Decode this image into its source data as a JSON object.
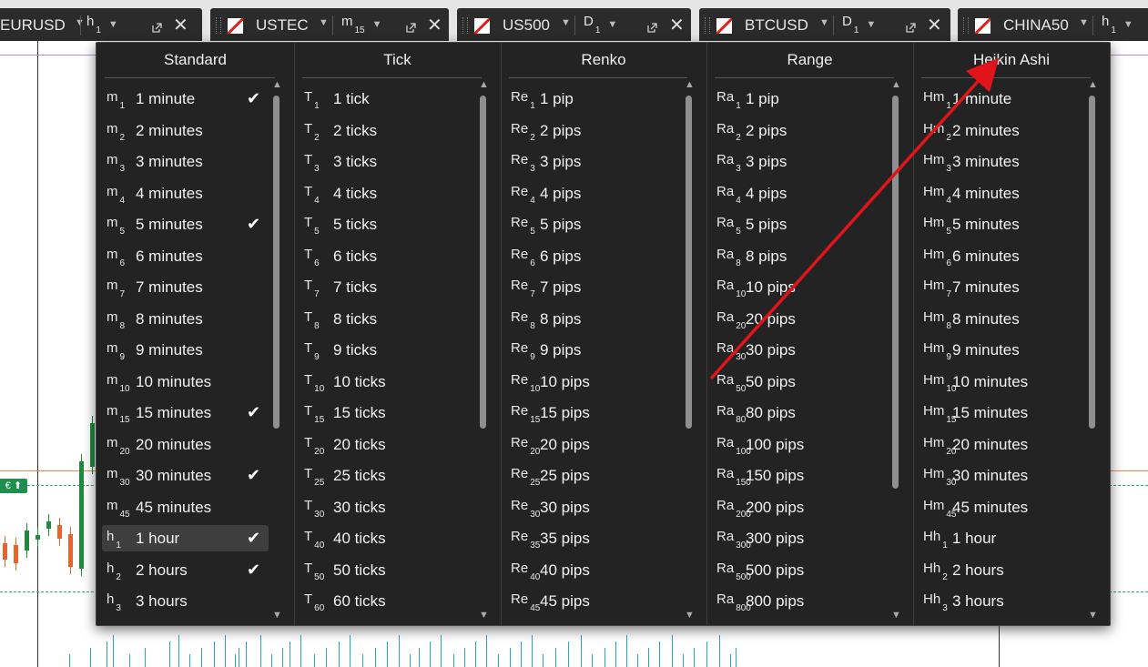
{
  "tabs": [
    {
      "symbol": "EURUSD",
      "timeframe": "h",
      "timeframe_sub": "1",
      "has_flag": false
    },
    {
      "symbol": "USTEC",
      "timeframe": "m",
      "timeframe_sub": "15",
      "has_flag": true
    },
    {
      "symbol": "US500",
      "timeframe": "D",
      "timeframe_sub": "1",
      "has_flag": true
    },
    {
      "symbol": "BTCUSD",
      "timeframe": "D",
      "timeframe_sub": "1",
      "has_flag": true
    },
    {
      "symbol": "CHINA50",
      "timeframe": "h",
      "timeframe_sub": "1",
      "has_flag": true
    }
  ],
  "price_badge": "€ ⬆",
  "columns": [
    {
      "title": "Standard",
      "items": [
        {
          "code": "m",
          "sub": "1",
          "label": "1 minute",
          "checked": true
        },
        {
          "code": "m",
          "sub": "2",
          "label": "2 minutes",
          "checked": false
        },
        {
          "code": "m",
          "sub": "3",
          "label": "3 minutes",
          "checked": false
        },
        {
          "code": "m",
          "sub": "4",
          "label": "4 minutes",
          "checked": false
        },
        {
          "code": "m",
          "sub": "5",
          "label": "5 minutes",
          "checked": true
        },
        {
          "code": "m",
          "sub": "6",
          "label": "6 minutes",
          "checked": false
        },
        {
          "code": "m",
          "sub": "7",
          "label": "7 minutes",
          "checked": false
        },
        {
          "code": "m",
          "sub": "8",
          "label": "8 minutes",
          "checked": false
        },
        {
          "code": "m",
          "sub": "9",
          "label": "9 minutes",
          "checked": false
        },
        {
          "code": "m",
          "sub": "10",
          "label": "10 minutes",
          "checked": false
        },
        {
          "code": "m",
          "sub": "15",
          "label": "15 minutes",
          "checked": true
        },
        {
          "code": "m",
          "sub": "20",
          "label": "20 minutes",
          "checked": false
        },
        {
          "code": "m",
          "sub": "30",
          "label": "30 minutes",
          "checked": true
        },
        {
          "code": "m",
          "sub": "45",
          "label": "45 minutes",
          "checked": false
        },
        {
          "code": "h",
          "sub": "1",
          "label": "1 hour",
          "checked": true,
          "selected": true
        },
        {
          "code": "h",
          "sub": "2",
          "label": "2 hours",
          "checked": true
        },
        {
          "code": "h",
          "sub": "3",
          "label": "3 hours",
          "checked": false
        }
      ]
    },
    {
      "title": "Tick",
      "items": [
        {
          "code": "T",
          "sub": "1",
          "label": "1 tick"
        },
        {
          "code": "T",
          "sub": "2",
          "label": "2 ticks"
        },
        {
          "code": "T",
          "sub": "3",
          "label": "3 ticks"
        },
        {
          "code": "T",
          "sub": "4",
          "label": "4 ticks"
        },
        {
          "code": "T",
          "sub": "5",
          "label": "5 ticks"
        },
        {
          "code": "T",
          "sub": "6",
          "label": "6 ticks"
        },
        {
          "code": "T",
          "sub": "7",
          "label": "7 ticks"
        },
        {
          "code": "T",
          "sub": "8",
          "label": "8 ticks"
        },
        {
          "code": "T",
          "sub": "9",
          "label": "9 ticks"
        },
        {
          "code": "T",
          "sub": "10",
          "label": "10 ticks"
        },
        {
          "code": "T",
          "sub": "15",
          "label": "15 ticks"
        },
        {
          "code": "T",
          "sub": "20",
          "label": "20 ticks"
        },
        {
          "code": "T",
          "sub": "25",
          "label": "25 ticks"
        },
        {
          "code": "T",
          "sub": "30",
          "label": "30 ticks"
        },
        {
          "code": "T",
          "sub": "40",
          "label": "40 ticks"
        },
        {
          "code": "T",
          "sub": "50",
          "label": "50 ticks"
        },
        {
          "code": "T",
          "sub": "60",
          "label": "60 ticks"
        }
      ]
    },
    {
      "title": "Renko",
      "items": [
        {
          "code": "Re",
          "sub": "1",
          "label": "1 pip"
        },
        {
          "code": "Re",
          "sub": "2",
          "label": "2 pips"
        },
        {
          "code": "Re",
          "sub": "3",
          "label": "3 pips"
        },
        {
          "code": "Re",
          "sub": "4",
          "label": "4 pips"
        },
        {
          "code": "Re",
          "sub": "5",
          "label": "5 pips"
        },
        {
          "code": "Re",
          "sub": "6",
          "label": "6 pips"
        },
        {
          "code": "Re",
          "sub": "7",
          "label": "7 pips"
        },
        {
          "code": "Re",
          "sub": "8",
          "label": "8 pips"
        },
        {
          "code": "Re",
          "sub": "9",
          "label": "9 pips"
        },
        {
          "code": "Re",
          "sub": "10",
          "label": "10 pips"
        },
        {
          "code": "Re",
          "sub": "15",
          "label": "15 pips"
        },
        {
          "code": "Re",
          "sub": "20",
          "label": "20 pips"
        },
        {
          "code": "Re",
          "sub": "25",
          "label": "25 pips"
        },
        {
          "code": "Re",
          "sub": "30",
          "label": "30 pips"
        },
        {
          "code": "Re",
          "sub": "35",
          "label": "35 pips"
        },
        {
          "code": "Re",
          "sub": "40",
          "label": "40 pips"
        },
        {
          "code": "Re",
          "sub": "45",
          "label": "45 pips"
        }
      ]
    },
    {
      "title": "Range",
      "items": [
        {
          "code": "Ra",
          "sub": "1",
          "label": "1 pip"
        },
        {
          "code": "Ra",
          "sub": "2",
          "label": "2 pips"
        },
        {
          "code": "Ra",
          "sub": "3",
          "label": "3 pips"
        },
        {
          "code": "Ra",
          "sub": "4",
          "label": "4 pips"
        },
        {
          "code": "Ra",
          "sub": "5",
          "label": "5 pips"
        },
        {
          "code": "Ra",
          "sub": "8",
          "label": "8 pips"
        },
        {
          "code": "Ra",
          "sub": "10",
          "label": "10 pips"
        },
        {
          "code": "Ra",
          "sub": "20",
          "label": "20 pips"
        },
        {
          "code": "Ra",
          "sub": "30",
          "label": "30 pips"
        },
        {
          "code": "Ra",
          "sub": "50",
          "label": "50 pips"
        },
        {
          "code": "Ra",
          "sub": "80",
          "label": "80 pips"
        },
        {
          "code": "Ra",
          "sub": "100",
          "label": "100 pips"
        },
        {
          "code": "Ra",
          "sub": "150",
          "label": "150 pips"
        },
        {
          "code": "Ra",
          "sub": "200",
          "label": "200 pips"
        },
        {
          "code": "Ra",
          "sub": "300",
          "label": "300 pips"
        },
        {
          "code": "Ra",
          "sub": "500",
          "label": "500 pips"
        },
        {
          "code": "Ra",
          "sub": "800",
          "label": "800 pips"
        }
      ]
    },
    {
      "title": "Heikin Ashi",
      "items": [
        {
          "code": "Hm",
          "sub": "1",
          "label": "1 minute"
        },
        {
          "code": "Hm",
          "sub": "2",
          "label": "2 minutes"
        },
        {
          "code": "Hm",
          "sub": "3",
          "label": "3 minutes"
        },
        {
          "code": "Hm",
          "sub": "4",
          "label": "4 minutes"
        },
        {
          "code": "Hm",
          "sub": "5",
          "label": "5 minutes"
        },
        {
          "code": "Hm",
          "sub": "6",
          "label": "6 minutes"
        },
        {
          "code": "Hm",
          "sub": "7",
          "label": "7 minutes"
        },
        {
          "code": "Hm",
          "sub": "8",
          "label": "8 minutes"
        },
        {
          "code": "Hm",
          "sub": "9",
          "label": "9 minutes"
        },
        {
          "code": "Hm",
          "sub": "10",
          "label": "10 minutes"
        },
        {
          "code": "Hm",
          "sub": "15",
          "label": "15 minutes"
        },
        {
          "code": "Hm",
          "sub": "20",
          "label": "20 minutes"
        },
        {
          "code": "Hm",
          "sub": "30",
          "label": "30 minutes"
        },
        {
          "code": "Hm",
          "sub": "45",
          "label": "45 minutes"
        },
        {
          "code": "Hh",
          "sub": "1",
          "label": "1 hour"
        },
        {
          "code": "Hh",
          "sub": "2",
          "label": "2 hours"
        },
        {
          "code": "Hh",
          "sub": "3",
          "label": "3 hours"
        }
      ]
    }
  ],
  "colors": {
    "menu_bg": "#232323",
    "tab_bg": "#2b2b2b",
    "annotation_arrow": "#e0141a",
    "bull_candle": "#1f8a3c",
    "bear_candle": "#e8642c",
    "volume": "#2aa7b4"
  }
}
